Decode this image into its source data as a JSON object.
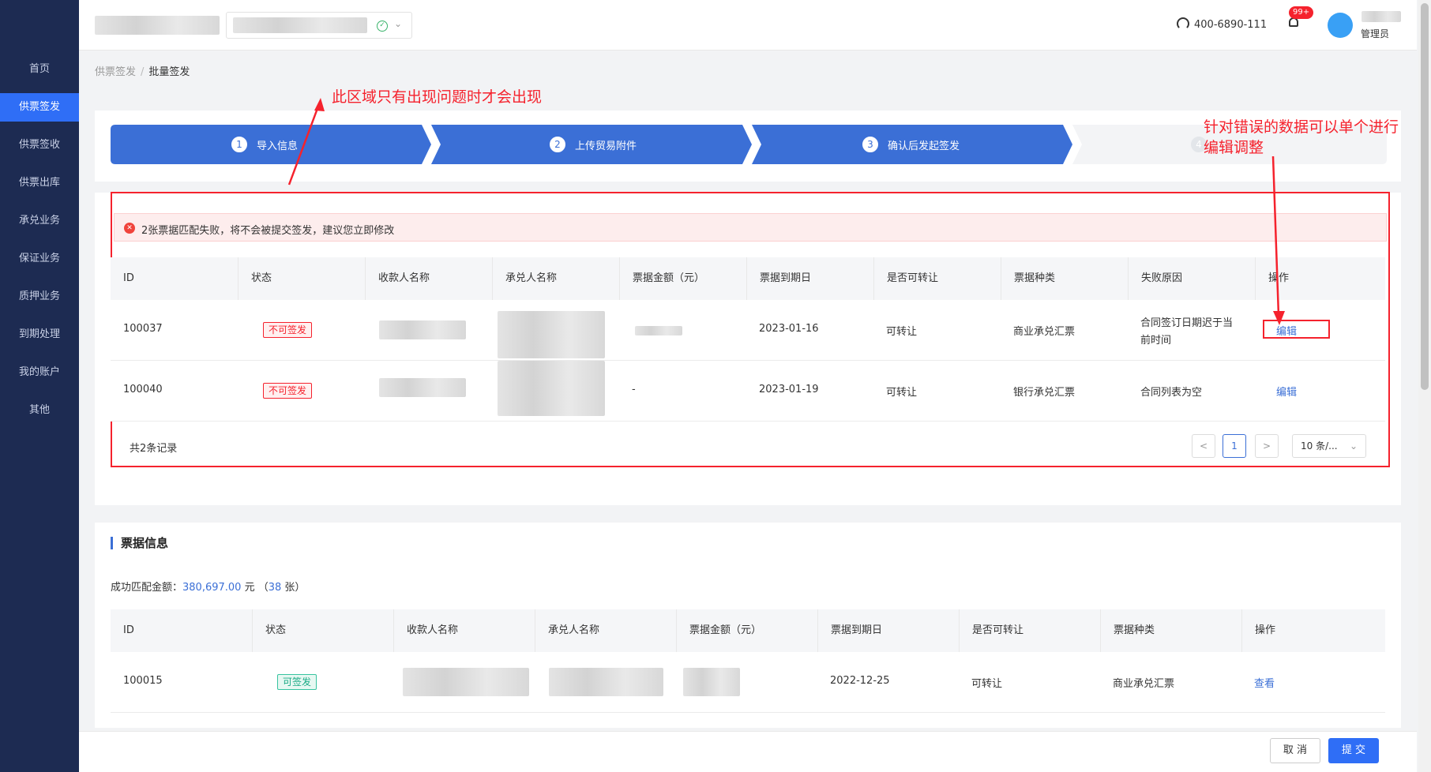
{
  "sidebar": {
    "items": [
      {
        "label": "首页"
      },
      {
        "label": "供票签发"
      },
      {
        "label": "供票签收"
      },
      {
        "label": "供票出库"
      },
      {
        "label": "承兑业务"
      },
      {
        "label": "保证业务"
      },
      {
        "label": "质押业务"
      },
      {
        "label": "到期处理"
      },
      {
        "label": "我的账户"
      },
      {
        "label": "其他"
      }
    ],
    "active_index": 1
  },
  "header": {
    "hotline": "400-6890-111",
    "notification_count": "99+",
    "user_role": "管理员"
  },
  "breadcrumb": {
    "parent": "供票签发",
    "separator": "/",
    "current": "批量签发"
  },
  "steps": [
    {
      "num": "1",
      "label": "导入信息"
    },
    {
      "num": "2",
      "label": "上传贸易附件"
    },
    {
      "num": "3",
      "label": "确认后发起签发"
    },
    {
      "num": "4",
      "label": ""
    }
  ],
  "error_section": {
    "alert": "2张票据匹配失败，将不会被提交签发，建议您立即修改",
    "columns": [
      "ID",
      "状态",
      "收款人名称",
      "承兑人名称",
      "票据金额（元）",
      "票据到期日",
      "是否可转让",
      "票据种类",
      "失败原因",
      "操作"
    ],
    "rows": [
      {
        "id": "100037",
        "status": "不可签发",
        "amount": "",
        "due": "2023-01-16",
        "transferable": "可转让",
        "type": "商业承兑汇票",
        "reason1": "合同签订日期迟于当",
        "reason2": "前时间",
        "action": "编辑"
      },
      {
        "id": "100040",
        "status": "不可签发",
        "amount": "-",
        "due": "2023-01-19",
        "transferable": "可转让",
        "type": "银行承兑汇票",
        "reason1": "合同列表为空",
        "reason2": "",
        "action": "编辑"
      }
    ],
    "total": "共2条记录",
    "pager": {
      "prev": "<",
      "page": "1",
      "next": ">",
      "size": "10 条/..."
    }
  },
  "annotations": {
    "region_note": "此区域只有出现问题时才会出现",
    "edit_note_1": "针对错误的数据可以单个进行",
    "edit_note_2": "编辑调整"
  },
  "bill_section": {
    "title": "票据信息",
    "summary_prefix": "成功匹配金额：",
    "summary_amount": "380,697.00",
    "summary_unit": " 元 （",
    "summary_count": "38",
    "summary_suffix": " 张）",
    "columns": [
      "ID",
      "状态",
      "收款人名称",
      "承兑人名称",
      "票据金额（元）",
      "票据到期日",
      "是否可转让",
      "票据种类",
      "操作"
    ],
    "rows": [
      {
        "id": "100015",
        "status": "可签发",
        "due": "2022-12-25",
        "transferable": "可转让",
        "type": "商业承兑汇票",
        "action": "查看"
      }
    ]
  },
  "footer": {
    "cancel": "取 消",
    "submit": "提 交"
  },
  "colors": {
    "primary": "#2f6ef6",
    "sidebar": "#1d2b52",
    "error": "#f5222d",
    "success": "#1aaa85"
  }
}
